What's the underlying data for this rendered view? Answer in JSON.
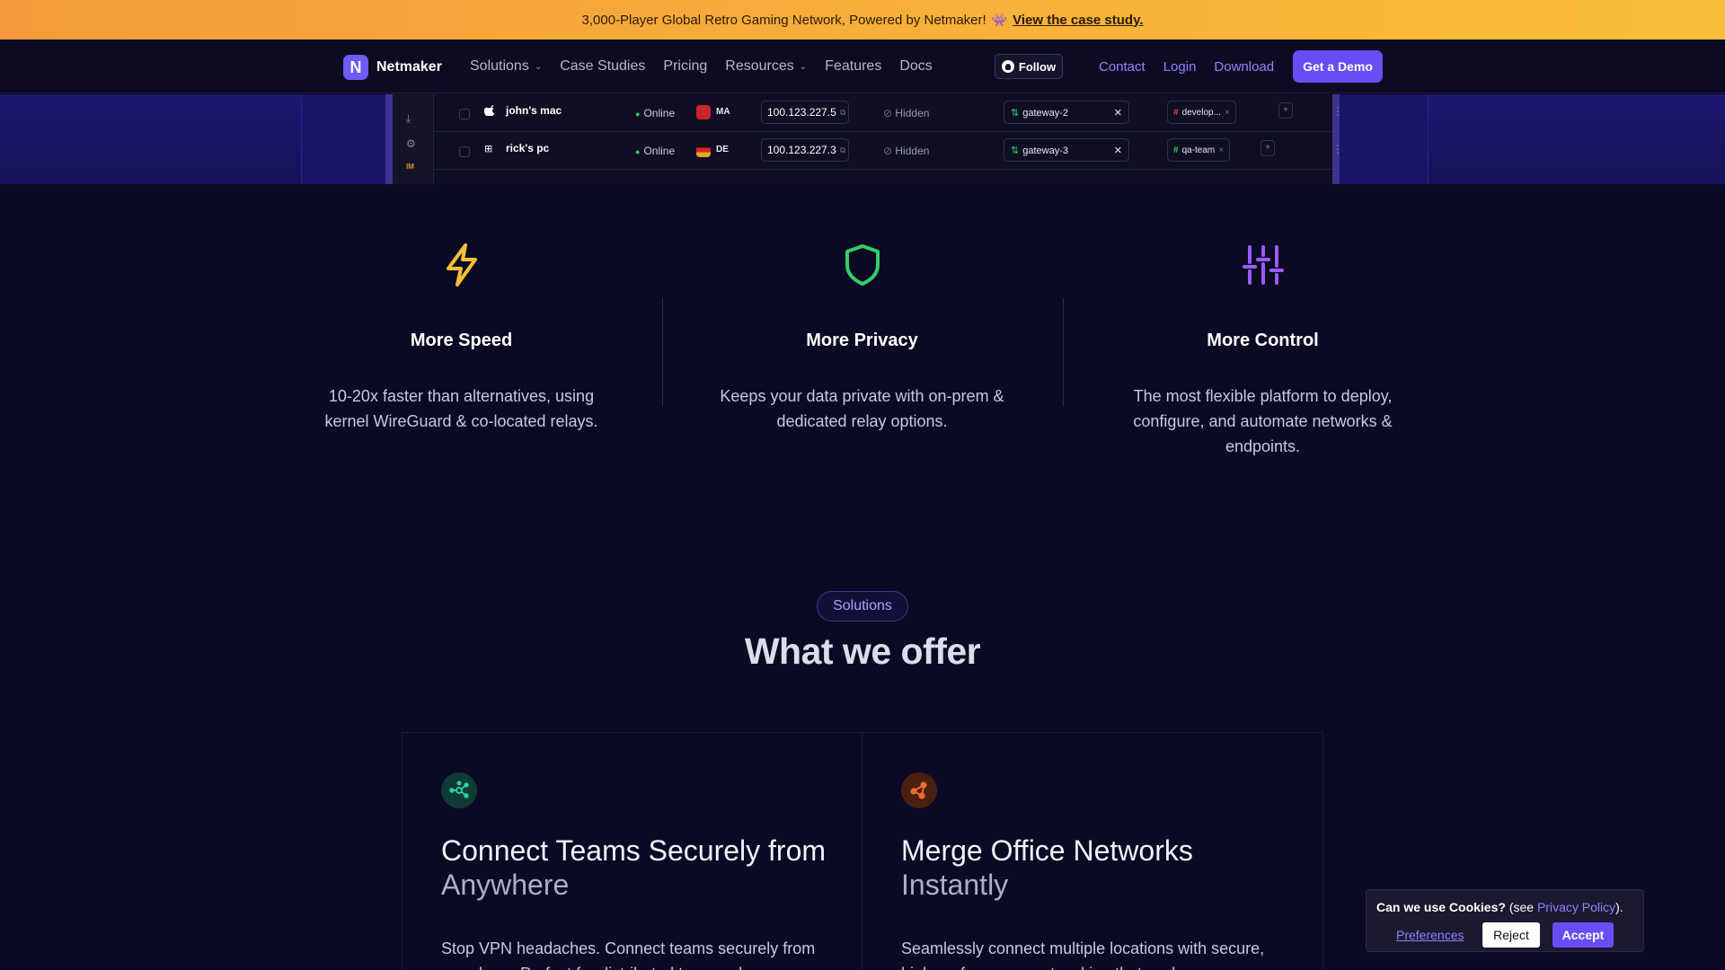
{
  "banner": {
    "text": "3,000-Player Global Retro Gaming Network, Powered by Netmaker!",
    "emoji": "👾",
    "link": "View the case study."
  },
  "nav": {
    "logo_text": "Netmaker",
    "logo_mark": "N",
    "items": [
      {
        "label": "Solutions",
        "dropdown": true
      },
      {
        "label": "Case Studies",
        "dropdown": false
      },
      {
        "label": "Pricing",
        "dropdown": false
      },
      {
        "label": "Resources",
        "dropdown": true
      },
      {
        "label": "Features",
        "dropdown": false
      },
      {
        "label": "Docs",
        "dropdown": false
      }
    ],
    "follow": "Follow",
    "contact": "Contact",
    "login": "Login",
    "download": "Download",
    "demo": "Get a Demo"
  },
  "preview": {
    "sidebar_icons": [
      "download-icon",
      "gear-icon",
      "badge-icon"
    ],
    "badge": "IM",
    "rows": [
      {
        "os_icon": "apple-icon",
        "os_glyph": "",
        "name": "john's mac",
        "status": "Online",
        "flag_color": "#c8242b",
        "country": "MA",
        "ip": "100.123.227.5",
        "visibility": "Hidden",
        "gateway": "gateway-2",
        "tag": "develop...",
        "tag_color": "#e0523c"
      },
      {
        "os_icon": "windows-icon",
        "os_glyph": "⊞",
        "name": "rick's pc",
        "status": "Online",
        "flag_color": "#e0a82e",
        "country": "DE",
        "ip": "100.123.227.3",
        "visibility": "Hidden",
        "gateway": "gateway-3",
        "tag": "qa-team",
        "tag_color": "#2fcf6a"
      }
    ]
  },
  "features": [
    {
      "icon": "lightning-icon",
      "color": "#f5c033",
      "title": "More Speed",
      "text": "10-20x faster than alternatives, using kernel WireGuard & co-located relays."
    },
    {
      "icon": "shield-icon",
      "color": "#2fcf6a",
      "title": "More Privacy",
      "text": "Keeps your data private with on-prem & dedicated relay options."
    },
    {
      "icon": "sliders-icon",
      "color": "#9b5cf6",
      "title": "More Control",
      "text": "The most flexible platform to deploy, configure, and automate networks & endpoints."
    }
  ],
  "solutions": {
    "pill": "Solutions",
    "title": "What we offer",
    "cards": [
      {
        "icon": "network-nodes-icon",
        "icon_color": "#2ed3a0",
        "icon_bg": "#0f3b34",
        "title_main": "Connect Teams Securely from ",
        "title_muted": "Anywhere",
        "text": "Stop VPN headaches. Connect teams securely from anywhere. Perfect for distributed teams who"
      },
      {
        "icon": "share-nodes-icon",
        "icon_color": "#f26b2a",
        "icon_bg": "#4a1f12",
        "title_main": "Merge Office Networks ",
        "title_muted": "Instantly",
        "text": "Seamlessly connect multiple locations with secure, high-performance networking that scales"
      }
    ]
  },
  "cookie": {
    "question": "Can we use Cookies?",
    "see": "(see",
    "policy": "Privacy Policy",
    "close_paren": ").",
    "preferences": "Preferences",
    "reject": "Reject",
    "accept": "Accept"
  }
}
